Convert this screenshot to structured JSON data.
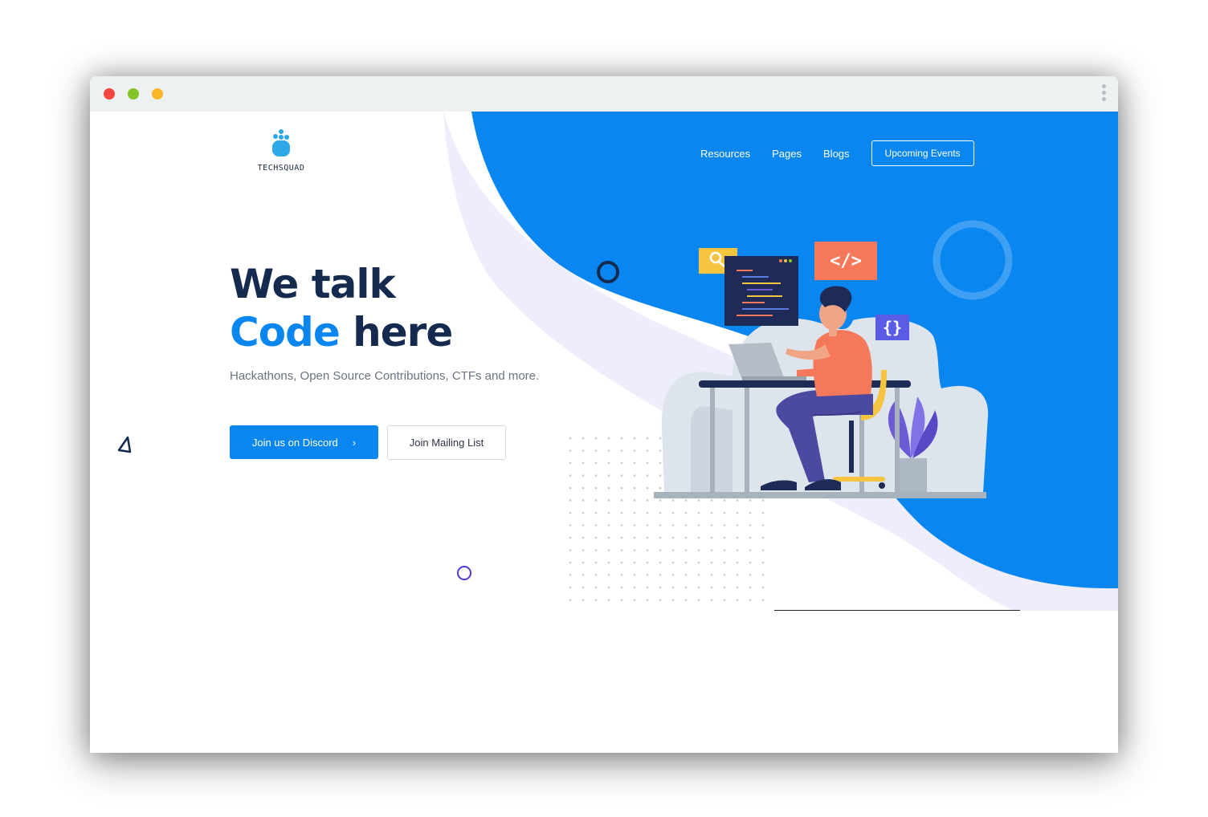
{
  "window": {
    "controls": [
      "close",
      "minimize",
      "maximize"
    ],
    "menu_icon": "kebab-icon"
  },
  "brand": {
    "name": "TECHSQUAD",
    "logo_icon": "hand-logo-icon"
  },
  "nav": {
    "items": [
      {
        "label": "Resources"
      },
      {
        "label": "Pages"
      },
      {
        "label": "Blogs"
      }
    ],
    "cta_label": "Upcoming Events"
  },
  "hero": {
    "title_line1": "We talk",
    "title_accent": "Code",
    "title_rest": " here",
    "subtitle": "Hackathons, Open Source Contributions, CTFs and more.",
    "primary_button": "Join us on Discord",
    "primary_icon": "chevron-right-icon",
    "secondary_button": "Join Mailing List"
  },
  "colors": {
    "accent": "#0a86f0",
    "heading": "#142a4f",
    "lavender": "#eeedfc"
  },
  "illustration": {
    "tags": [
      "</>",
      "{}"
    ],
    "icons": [
      "search-icon",
      "code-window-icon",
      "plant-icon"
    ]
  }
}
